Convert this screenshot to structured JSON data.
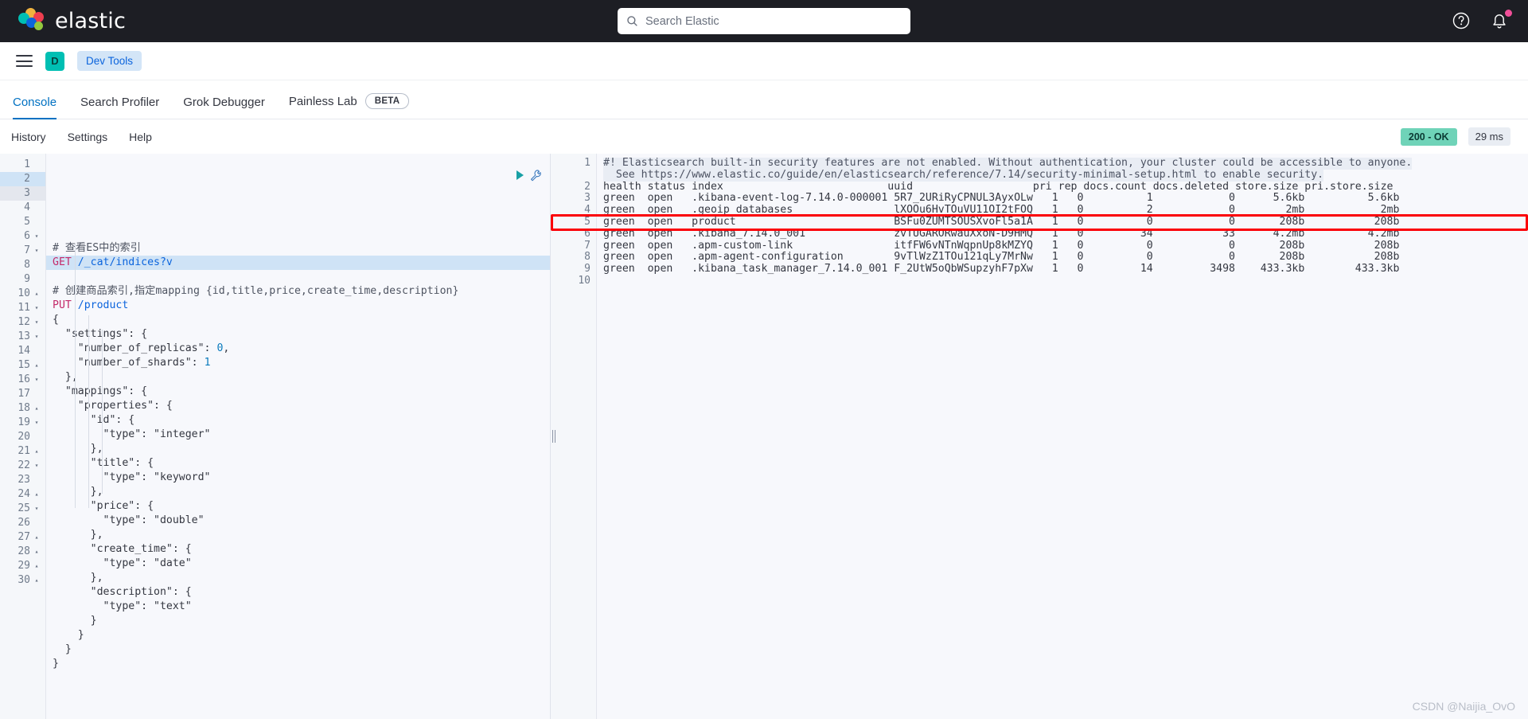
{
  "topbar": {
    "brand": "elastic",
    "search_placeholder": "Search Elastic",
    "search_value": "",
    "icons": {
      "help": "help-icon",
      "notifications": "notifications-icon"
    }
  },
  "nav": {
    "menu_icon": "hamburger-menu-icon",
    "space_initial": "D",
    "breadcrumb": "Dev Tools"
  },
  "tabs": [
    {
      "label": "Console",
      "active": true
    },
    {
      "label": "Search Profiler",
      "active": false
    },
    {
      "label": "Grok Debugger",
      "active": false
    },
    {
      "label": "Painless Lab",
      "active": false,
      "badge": "BETA"
    }
  ],
  "console_toolbar": {
    "history": "History",
    "settings": "Settings",
    "help": "Help",
    "status": "200 - OK",
    "time": "29 ms"
  },
  "editor": {
    "lines": [
      {
        "n": "1",
        "fold": "",
        "text": "# 查看ES中的索引"
      },
      {
        "n": "2",
        "fold": "",
        "text": "GET /_cat/indices?v"
      },
      {
        "n": "3",
        "fold": "",
        "text": ""
      },
      {
        "n": "4",
        "fold": "",
        "text": "# 创建商品索引,指定mapping {id,title,price,create_time,description}"
      },
      {
        "n": "5",
        "fold": "",
        "text": "PUT /product"
      },
      {
        "n": "6",
        "fold": "▾",
        "text": "{"
      },
      {
        "n": "7",
        "fold": "▾",
        "text": "  \"settings\": {"
      },
      {
        "n": "8",
        "fold": "",
        "text": "    \"number_of_replicas\": 0,"
      },
      {
        "n": "9",
        "fold": "",
        "text": "    \"number_of_shards\": 1"
      },
      {
        "n": "10",
        "fold": "▴",
        "text": "  },"
      },
      {
        "n": "11",
        "fold": "▾",
        "text": "  \"mappings\": {"
      },
      {
        "n": "12",
        "fold": "▾",
        "text": "    \"properties\": {"
      },
      {
        "n": "13",
        "fold": "▾",
        "text": "      \"id\": {"
      },
      {
        "n": "14",
        "fold": "",
        "text": "        \"type\": \"integer\""
      },
      {
        "n": "15",
        "fold": "▴",
        "text": "      },"
      },
      {
        "n": "16",
        "fold": "▾",
        "text": "      \"title\": {"
      },
      {
        "n": "17",
        "fold": "",
        "text": "        \"type\": \"keyword\""
      },
      {
        "n": "18",
        "fold": "▴",
        "text": "      },"
      },
      {
        "n": "19",
        "fold": "▾",
        "text": "      \"price\": {"
      },
      {
        "n": "20",
        "fold": "",
        "text": "        \"type\": \"double\""
      },
      {
        "n": "21",
        "fold": "▴",
        "text": "      },"
      },
      {
        "n": "22",
        "fold": "▾",
        "text": "      \"create_time\": {"
      },
      {
        "n": "23",
        "fold": "",
        "text": "        \"type\": \"date\""
      },
      {
        "n": "24",
        "fold": "▴",
        "text": "      },"
      },
      {
        "n": "25",
        "fold": "▾",
        "text": "      \"description\": {"
      },
      {
        "n": "26",
        "fold": "",
        "text": "        \"type\": \"text\""
      },
      {
        "n": "27",
        "fold": "▴",
        "text": "      }"
      },
      {
        "n": "28",
        "fold": "▴",
        "text": "    }"
      },
      {
        "n": "29",
        "fold": "▴",
        "text": "  }"
      },
      {
        "n": "30",
        "fold": "▴",
        "text": "}"
      }
    ],
    "actions": {
      "play": "run-request-icon",
      "wrench": "request-options-icon"
    }
  },
  "response": {
    "warning_line1": "#! Elasticsearch built-in security features are not enabled. Without authentication, your cluster could be accessible to anyone.",
    "warning_line2": "See https://www.elastic.co/guide/en/elasticsearch/reference/7.14/security-minimal-setup.html to enable security.",
    "header": "health status index                          uuid                   pri rep docs.count docs.deleted store.size pri.store.size",
    "rows": [
      "green  open   .kibana-event-log-7.14.0-000001 5R7_2URiRyCPNUL3AyxOLw   1   0          1            0      5.6kb          5.6kb",
      "green  open   .geoip_databases                lXOOu6HvTOuVU11OI2tFOQ   1   0          2            0        2mb            2mb",
      "green  open   product                         BSFu0ZUMTSOUSXvoFl5a1A   1   0          0            0       208b           208b",
      "green  open   .kibana_7.14.0_001              zvTUGARORwauXxoN-D9HMQ   1   0         34           33      4.2mb          4.2mb",
      "green  open   .apm-custom-link                itfFW6vNTnWqpnUp8kMZYQ   1   0          0            0       208b           208b",
      "green  open   .apm-agent-configuration        9vTlWzZ1TOu121qLy7MrNw   1   0          0            0       208b           208b",
      "green  open   .kibana_task_manager_7.14.0_001 F_2UtW5oQbWSupzyhF7pXw   1   0         14         3498    433.3kb        433.3kb"
    ],
    "line_numbers": [
      "1",
      "2",
      "3",
      "4",
      "5",
      "6",
      "7",
      "8",
      "9",
      "10"
    ],
    "highlight_row_index": 2
  },
  "watermark": "CSDN @Naijia_OvO",
  "colors": {
    "accent": "#0071c2",
    "brand_teal": "#00bfb3",
    "status_green": "#6fd3b8",
    "highlight_red": "#fb0007",
    "topbar_bg": "#1d1e24"
  }
}
